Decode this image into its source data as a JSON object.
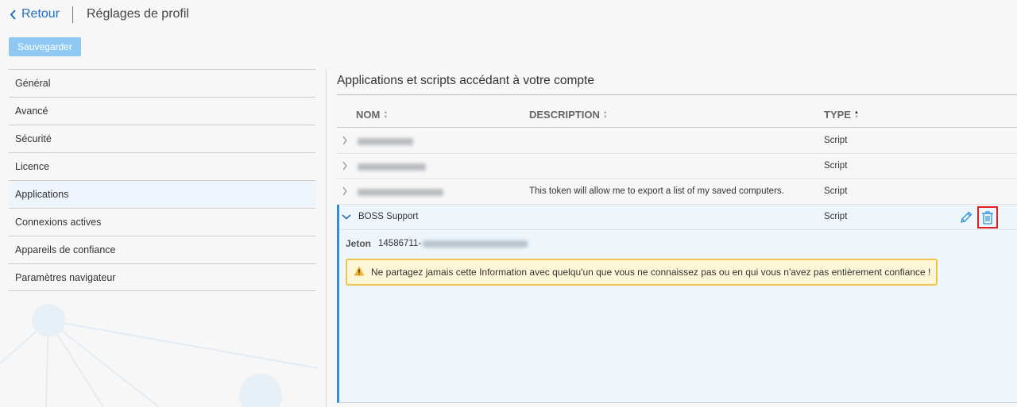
{
  "header": {
    "back_label": "Retour",
    "title": "Réglages de profil",
    "save_label": "Sauvegarder"
  },
  "sidebar": {
    "items": [
      {
        "label": "Général"
      },
      {
        "label": "Avancé"
      },
      {
        "label": "Sécurité"
      },
      {
        "label": "Licence"
      },
      {
        "label": "Applications",
        "active": true
      },
      {
        "label": "Connexions actives"
      },
      {
        "label": "Appareils de confiance"
      },
      {
        "label": "Paramètres navigateur"
      }
    ]
  },
  "main": {
    "section_title": "Applications et scripts accédant à votre compte",
    "columns": {
      "name": "NOM",
      "description": "DESCRIPTION",
      "type": "TYPE"
    },
    "rows": [
      {
        "name_redacted": true,
        "description": "",
        "type": "Script"
      },
      {
        "name_redacted": true,
        "description": "",
        "type": "Script"
      },
      {
        "name_redacted": true,
        "description": "This token will allow me to export a list of my saved computers.",
        "type": "Script"
      }
    ],
    "expanded_row": {
      "name": "BOSS Support",
      "type": "Script",
      "token_label": "Jeton",
      "token_prefix": "14586711-",
      "warning": "Ne partagez jamais cette Information avec quelqu'un que vous ne connaissez pas ou en qui vous n'avez pas entièrement confiance !"
    }
  },
  "icons": {
    "back": "chevron-left-icon",
    "expand": "chevron-right-icon",
    "collapse": "chevron-down-icon",
    "edit": "pencil-icon",
    "delete": "trash-icon",
    "warning": "warning-icon"
  },
  "colors": {
    "accent": "#1f6fc5",
    "save_button": "#8fc9f3",
    "highlight_border": "#e02020",
    "warning_border": "#f0c44a",
    "warning_bg": "#fdf7d8"
  }
}
